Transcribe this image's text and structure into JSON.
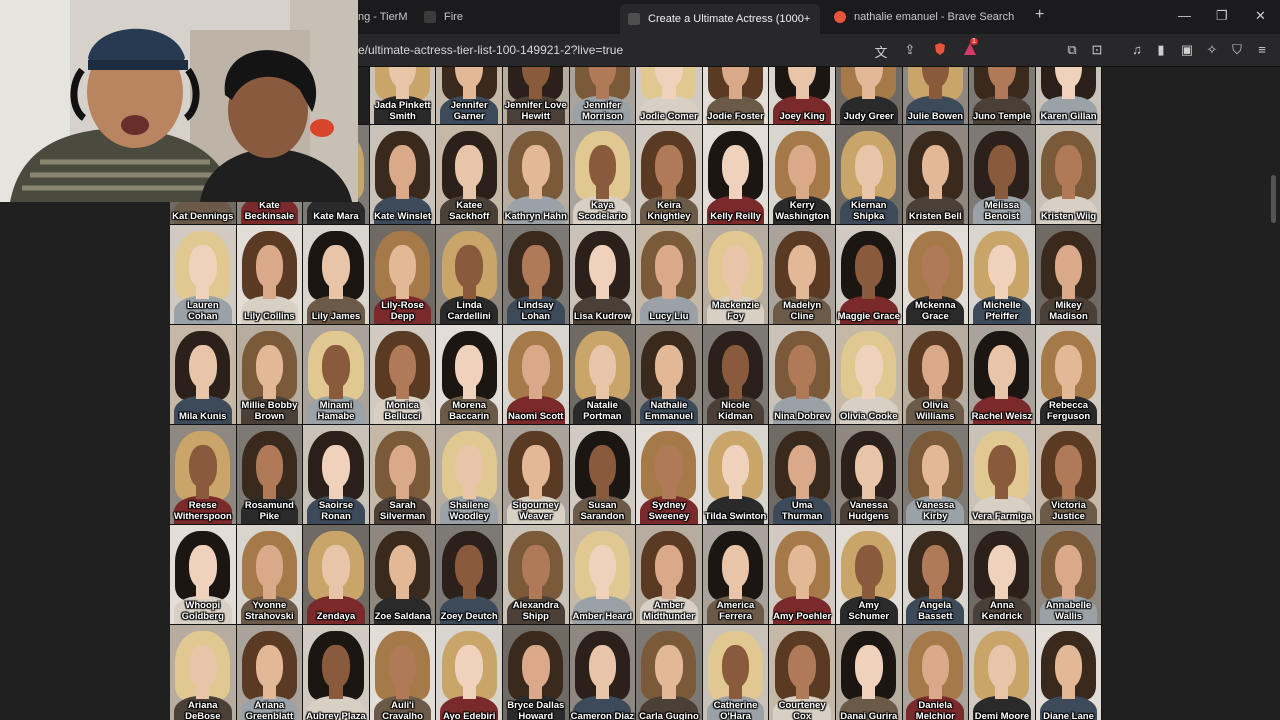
{
  "browser": {
    "tabs": [
      {
        "label": "ng - TierM",
        "active": false,
        "favicon_color": "#4a4a4a"
      },
      {
        "label": "Fire",
        "active": false,
        "favicon_color": "#3b3b3b"
      },
      {
        "label": "Create a Ultimate Actress (1000+",
        "active": true,
        "favicon_color": "#4e4e4e",
        "close": "✕"
      },
      {
        "label": "nathalie emanuel - Brave Search",
        "active": false,
        "favicon_color": "#e8553d"
      }
    ],
    "new_tab": "+",
    "window_controls": {
      "minimize": "—",
      "restore": "❐",
      "close": "✕"
    },
    "url": "e/ultimate-actress-tier-list-100-149921-2?live=true",
    "notification_badge": "1"
  },
  "grid": {
    "rows": [
      [
        "Jada Pinkett Smith",
        "Jennifer Garner",
        "Jennifer Love Hewitt",
        "Jennifer Morrison",
        "Jodie Comer",
        "Jodie Foster",
        "Joey King",
        "Judy Greer",
        "Julie Bowen",
        "Juno Temple",
        "Karen Gillan"
      ],
      [
        "Kat Dennings",
        "Kate Beckinsale",
        "Kate Mara",
        "Kate Winslet",
        "Katee Sackhoff",
        "Kathryn Hahn",
        "Kaya Scodelario",
        "Keira Knightley",
        "Kelly Reilly",
        "Kerry Washington",
        "Kiernan Shipka",
        "Kristen Bell",
        "Melissa Benoist",
        "Kristen Wiig"
      ],
      [
        "Lauren Cohan",
        "Lily Collins",
        "Lily James",
        "Lily-Rose Depp",
        "Linda Cardellini",
        "Lindsay Lohan",
        "Lisa Kudrow",
        "Lucy Liu",
        "Mackenzie Foy",
        "Madelyn Cline",
        "Maggie Grace",
        "Mckenna Grace",
        "Michelle Pfeiffer",
        "Mikey Madison"
      ],
      [
        "Mila Kunis",
        "Millie Bobby Brown",
        "Minami Hamabe",
        "Monica Bellucci",
        "Morena Baccarin",
        "Naomi Scott",
        "Natalie Portman",
        "Nathalie Emmanuel",
        "Nicole Kidman",
        "Nina Dobrev",
        "Olivia Cooke",
        "Olivia Williams",
        "Rachel Weisz",
        "Rebecca Ferguson"
      ],
      [
        "Reese Witherspoon",
        "Rosamund Pike",
        "Saoirse Ronan",
        "Sarah Silverman",
        "Shailene Woodley",
        "Sigourney Weaver",
        "Susan Sarandon",
        "Sydney Sweeney",
        "Tilda Swinton",
        "Uma Thurman",
        "Vanessa Hudgens",
        "Vanessa Kirby",
        "Vera Farmiga",
        "Victoria Justice"
      ],
      [
        "Whoopi Goldberg",
        "Yvonne Strahovski",
        "Zendaya",
        "Zoe Saldana",
        "Zoey Deutch",
        "Alexandra Shipp",
        "Amber Heard",
        "Amber Midthunder",
        "America Ferrera",
        "Amy Poehler",
        "Amy Schumer",
        "Angela Bassett",
        "Anna Kendrick",
        "Annabelle Wallis"
      ],
      [
        "Ariana DeBose",
        "Ariana Greenblatt",
        "Aubrey Plaza",
        "Auli'i Cravalho",
        "Ayo Edebiri",
        "Bryce Dallas Howard",
        "Cameron Diaz",
        "Carla Gugino",
        "Catherine O'Hara",
        "Courteney Cox",
        "Danai Gurira",
        "Daniela Melchior",
        "Demi Moore",
        "Diane Lane"
      ]
    ],
    "bg_colors": [
      "#c9c2b8",
      "#a9a39b",
      "#d8d4ce",
      "#7d7a75",
      "#b7aca0",
      "#e2ddd6",
      "#8f8880",
      "#c5b8a6",
      "#d0cac2",
      "#6f6a64"
    ],
    "hair_colors": [
      "#3a2a1e",
      "#1c1612",
      "#7a5a38",
      "#c9a56a",
      "#5a3a22",
      "#2b211a",
      "#a67a48",
      "#e0c890"
    ],
    "skin_colors": [
      "#e8c4a8",
      "#d9a98a",
      "#f0d2bc",
      "#b07a58",
      "#8a5a3c",
      "#e2b896"
    ],
    "cloth_colors": [
      "#2a2a2a",
      "#6b5a48",
      "#9aa2a8",
      "#3c4a5a",
      "#7a2a2a",
      "#d8d0c4",
      "#4a4038"
    ]
  }
}
